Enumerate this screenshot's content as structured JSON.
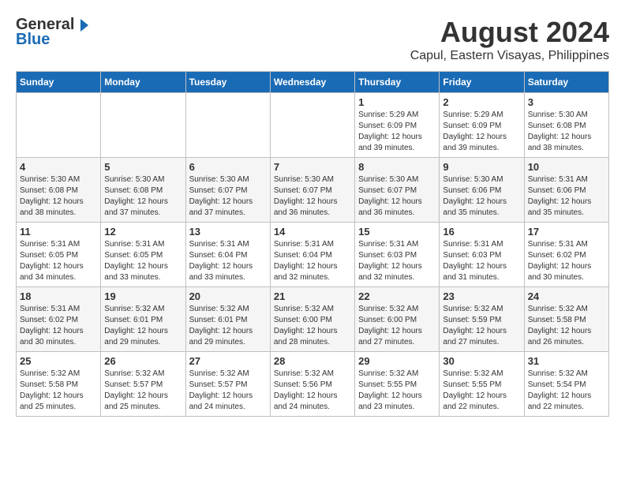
{
  "header": {
    "logo": {
      "general": "General",
      "blue": "Blue"
    },
    "title": "August 2024",
    "subtitle": "Capul, Eastern Visayas, Philippines"
  },
  "days_of_week": [
    "Sunday",
    "Monday",
    "Tuesday",
    "Wednesday",
    "Thursday",
    "Friday",
    "Saturday"
  ],
  "weeks": [
    {
      "cells": [
        {
          "empty": true
        },
        {
          "empty": true
        },
        {
          "empty": true
        },
        {
          "empty": true
        },
        {
          "day": 1,
          "sunrise": "5:29 AM",
          "sunset": "6:09 PM",
          "daylight": "12 hours and 39 minutes."
        },
        {
          "day": 2,
          "sunrise": "5:29 AM",
          "sunset": "6:09 PM",
          "daylight": "12 hours and 39 minutes."
        },
        {
          "day": 3,
          "sunrise": "5:30 AM",
          "sunset": "6:08 PM",
          "daylight": "12 hours and 38 minutes."
        }
      ]
    },
    {
      "cells": [
        {
          "day": 4,
          "sunrise": "5:30 AM",
          "sunset": "6:08 PM",
          "daylight": "12 hours and 38 minutes."
        },
        {
          "day": 5,
          "sunrise": "5:30 AM",
          "sunset": "6:08 PM",
          "daylight": "12 hours and 37 minutes."
        },
        {
          "day": 6,
          "sunrise": "5:30 AM",
          "sunset": "6:07 PM",
          "daylight": "12 hours and 37 minutes."
        },
        {
          "day": 7,
          "sunrise": "5:30 AM",
          "sunset": "6:07 PM",
          "daylight": "12 hours and 36 minutes."
        },
        {
          "day": 8,
          "sunrise": "5:30 AM",
          "sunset": "6:07 PM",
          "daylight": "12 hours and 36 minutes."
        },
        {
          "day": 9,
          "sunrise": "5:30 AM",
          "sunset": "6:06 PM",
          "daylight": "12 hours and 35 minutes."
        },
        {
          "day": 10,
          "sunrise": "5:31 AM",
          "sunset": "6:06 PM",
          "daylight": "12 hours and 35 minutes."
        }
      ]
    },
    {
      "cells": [
        {
          "day": 11,
          "sunrise": "5:31 AM",
          "sunset": "6:05 PM",
          "daylight": "12 hours and 34 minutes."
        },
        {
          "day": 12,
          "sunrise": "5:31 AM",
          "sunset": "6:05 PM",
          "daylight": "12 hours and 33 minutes."
        },
        {
          "day": 13,
          "sunrise": "5:31 AM",
          "sunset": "6:04 PM",
          "daylight": "12 hours and 33 minutes."
        },
        {
          "day": 14,
          "sunrise": "5:31 AM",
          "sunset": "6:04 PM",
          "daylight": "12 hours and 32 minutes."
        },
        {
          "day": 15,
          "sunrise": "5:31 AM",
          "sunset": "6:03 PM",
          "daylight": "12 hours and 32 minutes."
        },
        {
          "day": 16,
          "sunrise": "5:31 AM",
          "sunset": "6:03 PM",
          "daylight": "12 hours and 31 minutes."
        },
        {
          "day": 17,
          "sunrise": "5:31 AM",
          "sunset": "6:02 PM",
          "daylight": "12 hours and 30 minutes."
        }
      ]
    },
    {
      "cells": [
        {
          "day": 18,
          "sunrise": "5:31 AM",
          "sunset": "6:02 PM",
          "daylight": "12 hours and 30 minutes."
        },
        {
          "day": 19,
          "sunrise": "5:32 AM",
          "sunset": "6:01 PM",
          "daylight": "12 hours and 29 minutes."
        },
        {
          "day": 20,
          "sunrise": "5:32 AM",
          "sunset": "6:01 PM",
          "daylight": "12 hours and 29 minutes."
        },
        {
          "day": 21,
          "sunrise": "5:32 AM",
          "sunset": "6:00 PM",
          "daylight": "12 hours and 28 minutes."
        },
        {
          "day": 22,
          "sunrise": "5:32 AM",
          "sunset": "6:00 PM",
          "daylight": "12 hours and 27 minutes."
        },
        {
          "day": 23,
          "sunrise": "5:32 AM",
          "sunset": "5:59 PM",
          "daylight": "12 hours and 27 minutes."
        },
        {
          "day": 24,
          "sunrise": "5:32 AM",
          "sunset": "5:58 PM",
          "daylight": "12 hours and 26 minutes."
        }
      ]
    },
    {
      "cells": [
        {
          "day": 25,
          "sunrise": "5:32 AM",
          "sunset": "5:58 PM",
          "daylight": "12 hours and 25 minutes."
        },
        {
          "day": 26,
          "sunrise": "5:32 AM",
          "sunset": "5:57 PM",
          "daylight": "12 hours and 25 minutes."
        },
        {
          "day": 27,
          "sunrise": "5:32 AM",
          "sunset": "5:57 PM",
          "daylight": "12 hours and 24 minutes."
        },
        {
          "day": 28,
          "sunrise": "5:32 AM",
          "sunset": "5:56 PM",
          "daylight": "12 hours and 24 minutes."
        },
        {
          "day": 29,
          "sunrise": "5:32 AM",
          "sunset": "5:55 PM",
          "daylight": "12 hours and 23 minutes."
        },
        {
          "day": 30,
          "sunrise": "5:32 AM",
          "sunset": "5:55 PM",
          "daylight": "12 hours and 22 minutes."
        },
        {
          "day": 31,
          "sunrise": "5:32 AM",
          "sunset": "5:54 PM",
          "daylight": "12 hours and 22 minutes."
        }
      ]
    }
  ]
}
